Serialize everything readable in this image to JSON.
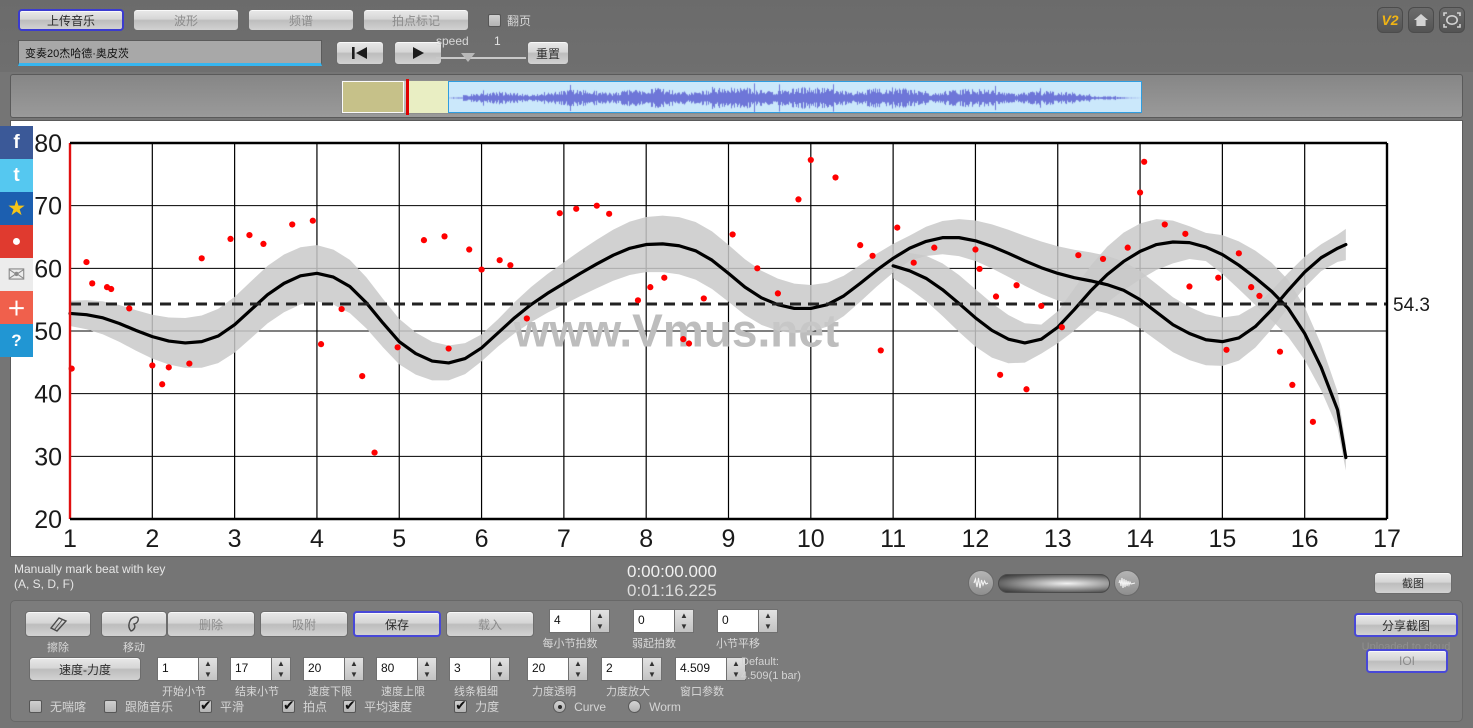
{
  "app": {
    "version_badge": "V2",
    "watermark": "www.Vmus.net"
  },
  "toolbar": {
    "tabs": [
      {
        "label": "上传音乐",
        "selected": true
      },
      {
        "label": "波形",
        "selected": false
      },
      {
        "label": "频谱",
        "selected": false
      },
      {
        "label": "拍点标记",
        "selected": false
      }
    ],
    "page_turn_label": "翻页",
    "page_turn_checked": false,
    "filename": "变奏20杰哈德·奥皮茨",
    "speed_label": "speed",
    "speed_value": "1",
    "reset_label": "重置",
    "icons": {
      "rewind": "rewind-to-start-icon",
      "play": "play-icon",
      "home": "home-icon",
      "fullscreen": "fullscreen-icon"
    }
  },
  "status": {
    "hint_line1": "Manually mark beat with key",
    "hint_line2": "(A, S, D, F)",
    "time_current": "0:00:00.000",
    "time_total": "0:01:16.225",
    "screenshot_label": "截图"
  },
  "bottom": {
    "tools": [
      {
        "label": "擦除",
        "icon": "eraser-icon"
      },
      {
        "label": "移动",
        "icon": "move-icon"
      }
    ],
    "actions": [
      {
        "label": "删除",
        "selected": false
      },
      {
        "label": "吸附",
        "selected": false
      },
      {
        "label": "保存",
        "selected": true
      },
      {
        "label": "载入",
        "selected": false
      }
    ],
    "mode_button": "速度-力度",
    "spinners_row_top": [
      {
        "value": "4",
        "caption": "每小节拍数"
      },
      {
        "value": "0",
        "caption": "弱起拍数"
      },
      {
        "value": "0",
        "caption": "小节平移"
      }
    ],
    "spinners_row_bottom": [
      {
        "value": "1",
        "caption": "开始小节"
      },
      {
        "value": "17",
        "caption": "结束小节"
      },
      {
        "value": "20",
        "caption": "速度下限"
      },
      {
        "value": "80",
        "caption": "速度上限"
      },
      {
        "value": "3",
        "caption": "线条粗细"
      },
      {
        "value": "20",
        "caption": "力度透明"
      },
      {
        "value": "2",
        "caption": "力度放大"
      },
      {
        "value": "4.509",
        "caption": "窗口参数"
      }
    ],
    "default_note_line1": "Default:",
    "default_note_line2": "4.509(1 bar)",
    "checkboxes": [
      {
        "label": "无喘喀",
        "checked": false
      },
      {
        "label": "跟随音乐",
        "checked": false
      },
      {
        "label": "平滑",
        "checked": true
      },
      {
        "label": "拍点",
        "checked": true
      },
      {
        "label": "平均速度",
        "checked": true
      },
      {
        "label": "力度",
        "checked": true
      }
    ],
    "radios": [
      {
        "label": "Curve",
        "selected": true
      },
      {
        "label": "Worm",
        "selected": false
      }
    ],
    "share_label": "分享截图",
    "cloud_label": "Uploaded to cloud",
    "ioi_label": "IOI"
  },
  "social": [
    {
      "name": "facebook-icon",
      "glyph": "f",
      "bg": "#3b5998",
      "fg": "#ffffff"
    },
    {
      "name": "twitter-icon",
      "glyph": "t",
      "bg": "#55c8f0",
      "fg": "#ffffff"
    },
    {
      "name": "qzone-icon",
      "glyph": "★",
      "bg": "#1c5fb0",
      "fg": "#f5c518"
    },
    {
      "name": "weibo-icon",
      "glyph": "●",
      "bg": "#e03a2f",
      "fg": "#ffffff"
    },
    {
      "name": "email-icon",
      "glyph": "✉",
      "bg": "#ececec",
      "fg": "#8a8a8a"
    },
    {
      "name": "more-share-icon",
      "glyph": "＋",
      "bg": "#f0604c",
      "fg": "#ffffff"
    },
    {
      "name": "help-icon",
      "glyph": "?",
      "bg": "#2196d3",
      "fg": "#ffffff"
    }
  ],
  "chart_data": {
    "type": "line",
    "title": "",
    "xlabel": "",
    "ylabel": "",
    "xlim": [
      1,
      17
    ],
    "ylim": [
      20,
      80
    ],
    "xticks": [
      1,
      2,
      3,
      4,
      5,
      6,
      7,
      8,
      9,
      10,
      11,
      12,
      13,
      14,
      15,
      16,
      17
    ],
    "yticks": [
      20,
      30,
      40,
      50,
      60,
      70,
      80
    ],
    "grid": true,
    "legend": "none",
    "reference_line": {
      "value": 54.3,
      "label": "54.3",
      "style": "dashed"
    },
    "series": [
      {
        "name": "tempo-curve",
        "kind": "line",
        "color": "#000000",
        "x": [
          1.0,
          1.2,
          1.4,
          1.6,
          1.8,
          2.0,
          2.2,
          2.4,
          2.6,
          2.8,
          3.0,
          3.2,
          3.4,
          3.6,
          3.8,
          4.0,
          4.2,
          4.4,
          4.6,
          4.8,
          5.0,
          5.2,
          5.4,
          5.6,
          5.8,
          6.0,
          6.2,
          6.4,
          6.6,
          6.8,
          7.0,
          7.2,
          7.4,
          7.6,
          7.8,
          8.0,
          8.2,
          8.4,
          8.6,
          8.8,
          9.0,
          9.2,
          9.4,
          9.6,
          9.8,
          10.0,
          10.2,
          10.4,
          10.6,
          10.8,
          11.0,
          11.2,
          11.4,
          11.6,
          11.8,
          12.0,
          12.2,
          12.4,
          12.6,
          12.8,
          13.0,
          13.2,
          13.4,
          13.6,
          13.8,
          14.0,
          14.2,
          14.4,
          14.6,
          14.8,
          15.0,
          15.2,
          15.4,
          15.6,
          15.8,
          16.0,
          16.2,
          16.4,
          16.5
        ],
        "y": [
          52.8,
          52.6,
          52.1,
          51.2,
          50.1,
          49.1,
          48.4,
          48.1,
          48.3,
          49.2,
          51.0,
          53.4,
          55.8,
          57.6,
          58.8,
          59.2,
          58.6,
          57.1,
          54.5,
          51.3,
          48.3,
          46.4,
          45.2,
          44.9,
          45.6,
          47.3,
          49.7,
          52.1,
          54.2,
          56.0,
          57.6,
          59.2,
          60.7,
          62.1,
          63.2,
          63.8,
          63.9,
          63.6,
          62.8,
          61.3,
          59.2,
          57.0,
          55.3,
          54.2,
          53.6,
          53.6,
          54.2,
          55.6,
          57.6,
          59.7,
          61.6,
          63.2,
          64.3,
          64.9,
          64.9,
          64.4,
          63.5,
          62.4,
          61.2,
          60.1,
          59.2,
          58.5,
          58.0,
          57.4,
          56.5,
          55.0,
          53.0,
          51.0,
          49.6,
          48.6,
          48.3,
          48.9,
          50.7,
          53.4,
          56.5,
          59.4,
          61.7,
          63.2,
          63.8
        ]
      },
      {
        "name": "tempo-curve-2",
        "kind": "line",
        "color": "#000000",
        "x": [
          11.0,
          11.2,
          11.4,
          11.6,
          11.8,
          12.0,
          12.2,
          12.4,
          12.6,
          12.8,
          13.0,
          13.2,
          13.4,
          13.6,
          13.8,
          14.0,
          14.2,
          14.4,
          14.6,
          14.8,
          15.0,
          15.2,
          15.4,
          15.6,
          15.8,
          16.0,
          16.2,
          16.4,
          16.5
        ],
        "y": [
          60.4,
          59.6,
          58.4,
          56.6,
          54.4,
          52.1,
          50.1,
          48.7,
          48.1,
          48.7,
          50.6,
          53.4,
          56.4,
          59.0,
          61.1,
          62.7,
          63.8,
          64.2,
          64.1,
          63.4,
          62.2,
          60.5,
          58.5,
          56.3,
          53.6,
          49.6,
          44.2,
          37.4,
          29.8
        ]
      },
      {
        "name": "beat-points",
        "kind": "scatter",
        "color": "#ff0000",
        "points": [
          [
            1.02,
            44.0
          ],
          [
            1.2,
            61.0
          ],
          [
            1.27,
            57.6
          ],
          [
            1.45,
            57.0
          ],
          [
            1.5,
            56.7
          ],
          [
            1.72,
            53.6
          ],
          [
            2.0,
            44.5
          ],
          [
            2.12,
            41.5
          ],
          [
            2.2,
            44.2
          ],
          [
            2.45,
            44.8
          ],
          [
            2.6,
            61.6
          ],
          [
            2.95,
            64.7
          ],
          [
            3.18,
            65.3
          ],
          [
            3.35,
            63.9
          ],
          [
            3.7,
            67.0
          ],
          [
            3.95,
            67.6
          ],
          [
            4.05,
            47.9
          ],
          [
            4.3,
            53.5
          ],
          [
            4.55,
            42.8
          ],
          [
            4.7,
            30.6
          ],
          [
            4.98,
            47.4
          ],
          [
            5.3,
            64.5
          ],
          [
            5.55,
            65.1
          ],
          [
            5.6,
            47.2
          ],
          [
            5.85,
            63.0
          ],
          [
            6.0,
            59.8
          ],
          [
            6.22,
            61.3
          ],
          [
            6.35,
            60.5
          ],
          [
            6.55,
            52.0
          ],
          [
            6.95,
            68.8
          ],
          [
            7.15,
            69.5
          ],
          [
            7.4,
            70.0
          ],
          [
            7.55,
            68.7
          ],
          [
            7.9,
            54.9
          ],
          [
            8.05,
            57.0
          ],
          [
            8.22,
            58.5
          ],
          [
            8.45,
            48.7
          ],
          [
            8.52,
            48.0
          ],
          [
            8.7,
            55.2
          ],
          [
            9.05,
            65.4
          ],
          [
            9.35,
            60.0
          ],
          [
            9.6,
            56.0
          ],
          [
            9.85,
            71.0
          ],
          [
            10.0,
            77.3
          ],
          [
            10.3,
            74.5
          ],
          [
            10.6,
            63.7
          ],
          [
            10.75,
            62.0
          ],
          [
            10.85,
            46.9
          ],
          [
            11.05,
            66.5
          ],
          [
            11.25,
            60.9
          ],
          [
            11.5,
            63.3
          ],
          [
            12.0,
            63.0
          ],
          [
            12.05,
            59.9
          ],
          [
            12.25,
            55.5
          ],
          [
            12.3,
            43.0
          ],
          [
            12.5,
            57.3
          ],
          [
            12.62,
            40.7
          ],
          [
            12.8,
            54.0
          ],
          [
            13.05,
            50.6
          ],
          [
            13.25,
            62.1
          ],
          [
            13.55,
            61.5
          ],
          [
            13.85,
            63.3
          ],
          [
            14.0,
            72.1
          ],
          [
            14.05,
            77.0
          ],
          [
            14.3,
            67.0
          ],
          [
            14.55,
            65.5
          ],
          [
            14.6,
            57.1
          ],
          [
            14.95,
            58.5
          ],
          [
            15.05,
            47.0
          ],
          [
            15.2,
            62.4
          ],
          [
            15.35,
            57.0
          ],
          [
            15.45,
            55.6
          ],
          [
            15.7,
            46.7
          ],
          [
            15.85,
            41.4
          ],
          [
            16.1,
            35.5
          ]
        ]
      }
    ]
  }
}
